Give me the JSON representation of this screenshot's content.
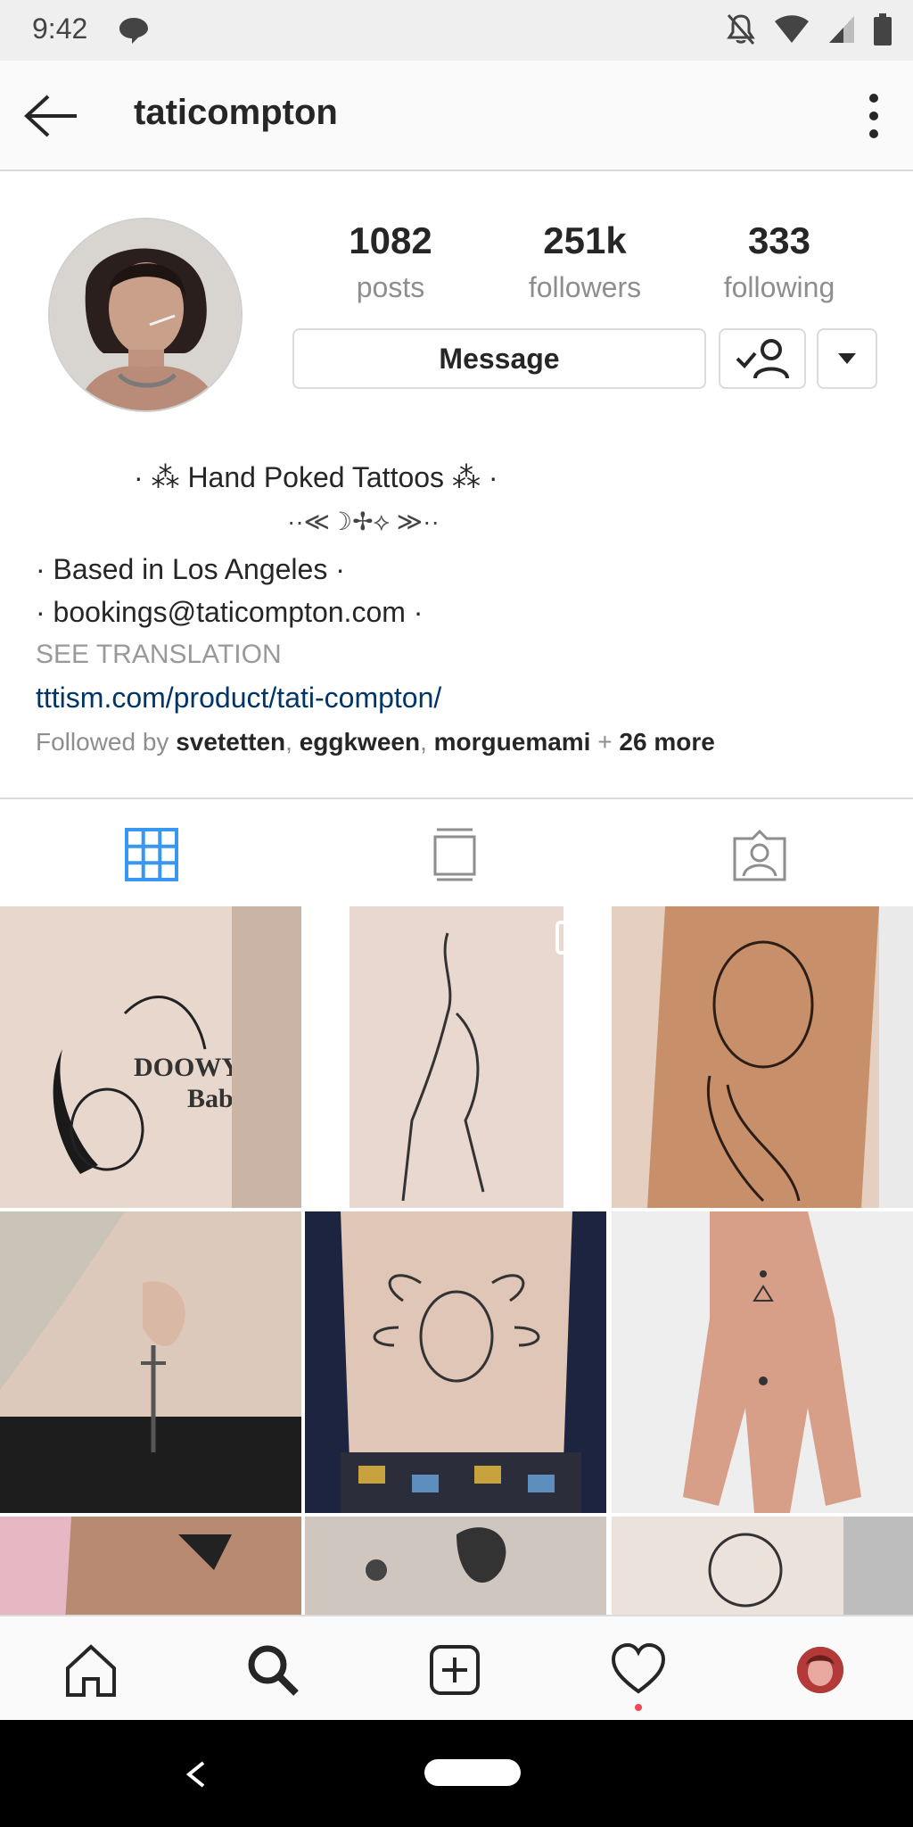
{
  "status_bar": {
    "time": "9:42",
    "icons": [
      "message-icon",
      "mute-icon",
      "wifi-icon",
      "signal-icon",
      "battery-icon"
    ]
  },
  "header": {
    "username": "taticompton",
    "icons": [
      "back-arrow-icon",
      "more-vertical-icon"
    ]
  },
  "profile": {
    "stats": [
      {
        "value": "1082",
        "label": "posts"
      },
      {
        "value": "251k",
        "label": "followers"
      },
      {
        "value": "333",
        "label": "following"
      }
    ],
    "message_button": "Message"
  },
  "bio": {
    "line1": "· ⁂ Hand Poked Tattoos ⁂ ·",
    "line2": "··≪☽✢⟡ ≫··",
    "line3": "· Based in Los Angeles ·",
    "line4": "· bookings@taticompton.com ·",
    "see_translation": "SEE TRANSLATION",
    "link": "tttism.com/product/tati-compton/"
  },
  "followed_by": {
    "prefix": "Followed by",
    "users": [
      "svetetten",
      "eggkween",
      "morguemami"
    ],
    "plus": "+",
    "more": "26 more"
  },
  "tabs": [
    {
      "icon": "grid-icon",
      "active": true
    },
    {
      "icon": "feed-icon",
      "active": false
    },
    {
      "icon": "tagged-icon",
      "active": false
    }
  ],
  "grid_posts": [
    {
      "description": "tattoo-arm-smoking-figure"
    },
    {
      "description": "tattoo-thigh-seated-woman"
    },
    {
      "description": "tattoo-forearm-beast"
    },
    {
      "description": "tattoo-neck-dagger"
    },
    {
      "description": "tattoo-sternum-medusa"
    },
    {
      "description": "tattoo-hand-ornament"
    },
    {
      "description": "tattoo-arm-pink"
    },
    {
      "description": "tattoo-arm-butterfly"
    },
    {
      "description": "tattoo-shoulder-portrait"
    }
  ],
  "bottom_nav": [
    "home-icon",
    "search-icon",
    "add-post-icon",
    "activity-heart-icon",
    "profile-avatar-icon"
  ],
  "colors": {
    "accent_blue": "#3897f0",
    "link_blue": "#003569",
    "notification_red": "#ed4956"
  }
}
